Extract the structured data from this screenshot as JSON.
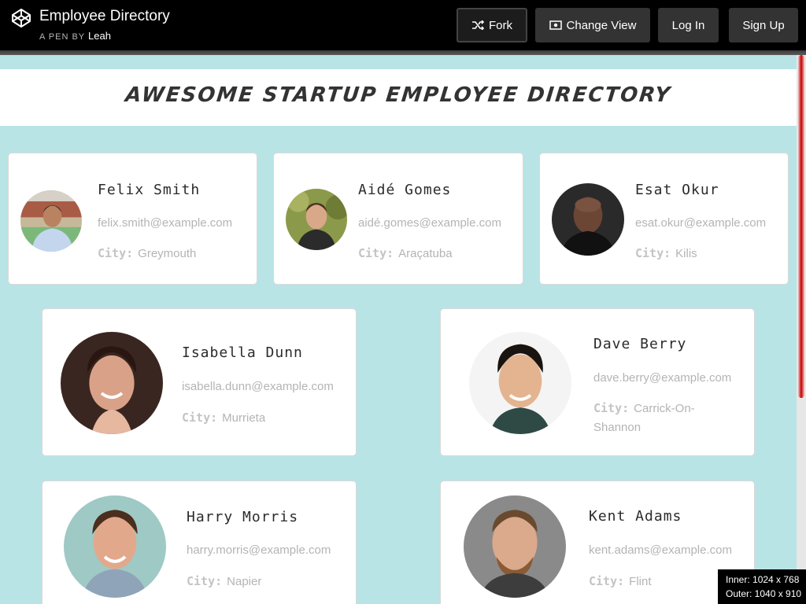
{
  "topbar": {
    "title": "Employee Directory",
    "by_prefix": "A PEN BY",
    "author": "Leah",
    "buttons": {
      "fork": "Fork",
      "change_view": "Change View",
      "login": "Log In",
      "signup": "Sign Up"
    }
  },
  "page": {
    "heading": "AWESOME STARTUP EMPLOYEE DIRECTORY"
  },
  "city_label": "City:",
  "employees": [
    {
      "name": "Felix Smith",
      "email": "felix.smith@example.com",
      "city": "Greymouth"
    },
    {
      "name": "Aidé Gomes",
      "email": "aidé.gomes@example.com",
      "city": "Araçatuba"
    },
    {
      "name": "Esat Okur",
      "email": "esat.okur@example.com",
      "city": "Kilis"
    },
    {
      "name": "Isabella Dunn",
      "email": "isabella.dunn@example.com",
      "city": "Murrieta"
    },
    {
      "name": "Dave Berry",
      "email": "dave.berry@example.com",
      "city": "Carrick-On-Shannon"
    },
    {
      "name": "Harry Morris",
      "email": "harry.morris@example.com",
      "city": "Napier"
    },
    {
      "name": "Kent Adams",
      "email": "kent.adams@example.com",
      "city": "Flint"
    }
  ],
  "viewport_badge": {
    "inner": "Inner: 1024 x 768",
    "outer": "Outer: 1040 x 910"
  },
  "colors": {
    "background": "#b9e4e6",
    "topbar": "#000000",
    "scroll_thumb": "#c80000"
  }
}
